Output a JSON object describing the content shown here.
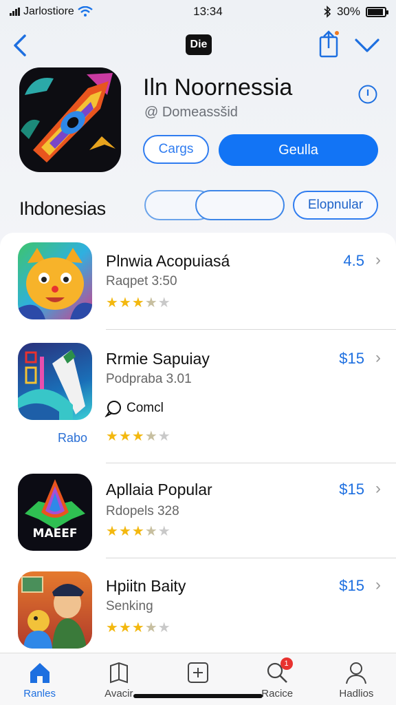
{
  "status_bar": {
    "carrier": "Jarlostiore",
    "time": "13:34",
    "battery": "30%",
    "battery_level": 0.9
  },
  "nav": {
    "logo_text": "Die"
  },
  "header": {
    "title": "Iln Noornessia",
    "subtitle": "@ Domeassšid",
    "outline_button": "Cargs",
    "primary_button": "Geulla"
  },
  "section": {
    "title": "Ihdonesias",
    "popular_button": "Elopnular"
  },
  "list": [
    {
      "name": "Plnwia Acopuiasá",
      "subtitle": "Raqpet 3:50",
      "price": "4.5",
      "rating": 3.5
    },
    {
      "name": "Rrmie Sapuiay",
      "subtitle": "Podpraba 3.01",
      "price": "$15",
      "rating": 3.5,
      "extra_label": "Comcl",
      "side_label": "Rabo"
    },
    {
      "name": "Apllaia Popular",
      "subtitle": "Rdopels 328",
      "price": "$15",
      "rating": 3.5
    },
    {
      "name": "Hpiitn Baity",
      "subtitle": "Senking",
      "price": "$15",
      "rating": 3.5
    }
  ],
  "tabs": [
    {
      "label": "Ranles",
      "icon": "home-icon",
      "active": true
    },
    {
      "label": "Avacir",
      "icon": "book-icon",
      "active": false
    },
    {
      "label": "",
      "icon": "add-square-icon",
      "active": false
    },
    {
      "label": "Racice",
      "icon": "search-icon",
      "active": false,
      "badge": "1"
    },
    {
      "label": "Hadlios",
      "icon": "person-icon",
      "active": false
    }
  ],
  "colors": {
    "accent": "#1274f5",
    "star": "#f3b80f",
    "badge": "#e8322f"
  }
}
